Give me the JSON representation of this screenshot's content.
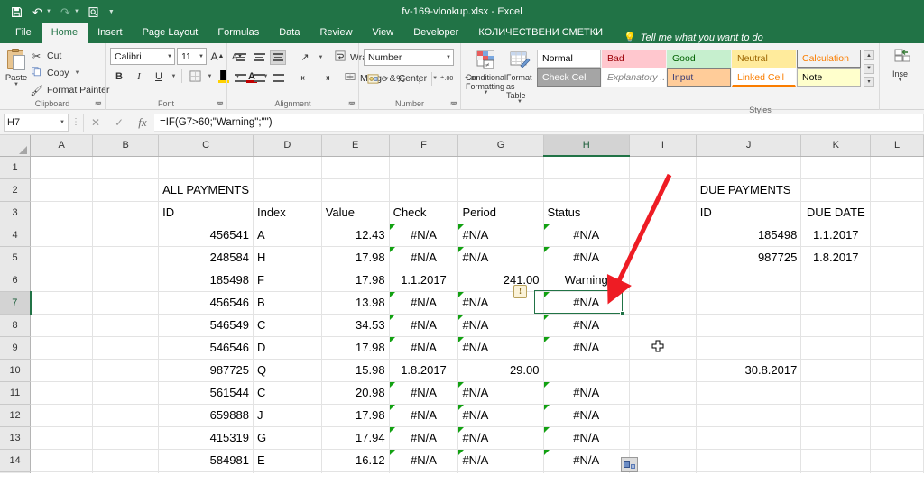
{
  "window": {
    "title": "fv-169-vlookup.xlsx  -  Excel",
    "quick_access": [
      {
        "name": "save",
        "glyph": "💾"
      },
      {
        "name": "undo",
        "glyph": "↶"
      },
      {
        "name": "redo",
        "glyph": "↷"
      },
      {
        "name": "print-preview",
        "glyph": "🖶"
      },
      {
        "name": "customize",
        "glyph": "▾"
      }
    ]
  },
  "ribbon": {
    "tabs": [
      {
        "label": "File",
        "active": false
      },
      {
        "label": "Home",
        "active": true
      },
      {
        "label": "Insert",
        "active": false
      },
      {
        "label": "Page Layout",
        "active": false
      },
      {
        "label": "Formulas",
        "active": false
      },
      {
        "label": "Data",
        "active": false
      },
      {
        "label": "Review",
        "active": false
      },
      {
        "label": "View",
        "active": false
      },
      {
        "label": "Developer",
        "active": false
      },
      {
        "label": "КОЛИЧЕСТВЕНИ СМЕТКИ",
        "active": false
      }
    ],
    "tell_me": "Tell me what you want to do",
    "groups": {
      "clipboard": {
        "label": "Clipboard",
        "paste": "Paste",
        "cut": "Cut",
        "copy": "Copy",
        "format_painter": "Format Painter"
      },
      "font": {
        "label": "Font",
        "font_name": "Calibri",
        "font_size": "11",
        "bold": "B",
        "italic": "I",
        "underline": "U"
      },
      "alignment": {
        "label": "Alignment",
        "wrap_text": "Wrap Text",
        "merge_center": "Merge & Center"
      },
      "number": {
        "label": "Number",
        "format": "Number",
        "percent": "%",
        "comma": ","
      },
      "styles": {
        "label": "Styles",
        "conditional_formatting": "Conditional Formatting",
        "format_as_table": "Format as Table",
        "cells": [
          {
            "label": "Normal",
            "bg": "#ffffff",
            "fg": "#000000",
            "border": "#c9c9c9"
          },
          {
            "label": "Bad",
            "bg": "#ffc7ce",
            "fg": "#9c0006",
            "border": "#ffc7ce"
          },
          {
            "label": "Good",
            "bg": "#c6efce",
            "fg": "#006100",
            "border": "#c6efce"
          },
          {
            "label": "Neutral",
            "bg": "#ffeb9c",
            "fg": "#9c6500",
            "border": "#ffeb9c"
          },
          {
            "label": "Calculation",
            "bg": "#f2f2f2",
            "fg": "#fa7d00",
            "border": "#7f7f7f"
          },
          {
            "label": "Check Cell",
            "bg": "#a5a5a5",
            "fg": "#ffffff",
            "border": "#7f7f7f"
          },
          {
            "label": "Explanatory ...",
            "bg": "#ffffff",
            "fg": "#7f7f7f",
            "border": "#ffffff"
          },
          {
            "label": "Input",
            "bg": "#ffcc99",
            "fg": "#3f3f76",
            "border": "#7f7f7f"
          },
          {
            "label": "Linked Cell",
            "bg": "#ffffff",
            "fg": "#fa7d00",
            "border": "#ffffff"
          },
          {
            "label": "Note",
            "bg": "#ffffcc",
            "fg": "#000000",
            "border": "#b2b2b2"
          }
        ]
      },
      "cells": {
        "label": "Insert",
        "insert": "Inse"
      }
    }
  },
  "formula_bar": {
    "name_box": "H7",
    "formula": "=IF(G7>60;\"Warning\";\"\")",
    "cancel_icon": "✕",
    "enter_icon": "✓",
    "fx_icon": "fx"
  },
  "sheet": {
    "columns": [
      "A",
      "B",
      "C",
      "D",
      "E",
      "F",
      "G",
      "H",
      "I",
      "J",
      "K",
      "L"
    ],
    "selected_column": "H",
    "selected_row": 7,
    "selected_cell": "H7",
    "rows": [
      {
        "n": 1,
        "cells": {}
      },
      {
        "n": 2,
        "cells": {
          "C": "ALL PAYMENTS",
          "J": "DUE PAYMENTS"
        }
      },
      {
        "n": 3,
        "cells": {
          "C": "ID",
          "D": "Index",
          "E": "Value",
          "F": "Check",
          "G": "Period",
          "H": "Status",
          "J": "ID",
          "K": "DUE DATE"
        }
      },
      {
        "n": 4,
        "cells": {
          "C": "456541",
          "D": "A",
          "E": "12.43",
          "F": "#N/A",
          "G": "#N/A",
          "H": "#N/A",
          "J": "185498",
          "K": "1.1.2017"
        }
      },
      {
        "n": 5,
        "cells": {
          "C": "248584",
          "D": "H",
          "E": "17.98",
          "F": "#N/A",
          "G": "#N/A",
          "H": "#N/A",
          "J": "987725",
          "K": "1.8.2017"
        }
      },
      {
        "n": 6,
        "cells": {
          "C": "185498",
          "D": "F",
          "E": "17.98",
          "F": "1.1.2017",
          "G": "241.00",
          "H": "Warning"
        }
      },
      {
        "n": 7,
        "cells": {
          "C": "456546",
          "D": "B",
          "E": "13.98",
          "F": "#N/A",
          "G": "#N/A",
          "H": "#N/A"
        }
      },
      {
        "n": 8,
        "cells": {
          "C": "546549",
          "D": "C",
          "E": "34.53",
          "F": "#N/A",
          "G": "#N/A",
          "H": "#N/A"
        }
      },
      {
        "n": 9,
        "cells": {
          "C": "546546",
          "D": "D",
          "E": "17.98",
          "F": "#N/A",
          "G": "#N/A",
          "H": "#N/A"
        }
      },
      {
        "n": 10,
        "cells": {
          "C": "987725",
          "D": "Q",
          "E": "15.98",
          "F": "1.8.2017",
          "G": "29.00",
          "J": "30.8.2017"
        }
      },
      {
        "n": 11,
        "cells": {
          "C": "561544",
          "D": "C",
          "E": "20.98",
          "F": "#N/A",
          "G": "#N/A",
          "H": "#N/A"
        }
      },
      {
        "n": 12,
        "cells": {
          "C": "659888",
          "D": "J",
          "E": "17.98",
          "F": "#N/A",
          "G": "#N/A",
          "H": "#N/A"
        }
      },
      {
        "n": 13,
        "cells": {
          "C": "415319",
          "D": "G",
          "E": "17.94",
          "F": "#N/A",
          "G": "#N/A",
          "H": "#N/A"
        }
      },
      {
        "n": 14,
        "cells": {
          "C": "584981",
          "D": "E",
          "E": "16.12",
          "F": "#N/A",
          "G": "#N/A",
          "H": "#N/A"
        }
      },
      {
        "n": 15,
        "cells": {}
      }
    ],
    "error_triangles": [
      {
        "row": 4,
        "cols": [
          "F",
          "G",
          "H"
        ]
      },
      {
        "row": 5,
        "cols": [
          "F",
          "G",
          "H"
        ]
      },
      {
        "row": 7,
        "cols": [
          "F",
          "G",
          "H"
        ]
      },
      {
        "row": 8,
        "cols": [
          "F",
          "G",
          "H"
        ]
      },
      {
        "row": 9,
        "cols": [
          "F",
          "G",
          "H"
        ]
      },
      {
        "row": 11,
        "cols": [
          "F",
          "G",
          "H"
        ]
      },
      {
        "row": 12,
        "cols": [
          "F",
          "G",
          "H"
        ]
      },
      {
        "row": 13,
        "cols": [
          "F",
          "G",
          "H"
        ]
      },
      {
        "row": 14,
        "cols": [
          "F",
          "G",
          "H"
        ]
      }
    ]
  },
  "annotation": {
    "arrow_color": "#ee1c24",
    "warning_badge": "!",
    "cursor": "move-cursor"
  }
}
